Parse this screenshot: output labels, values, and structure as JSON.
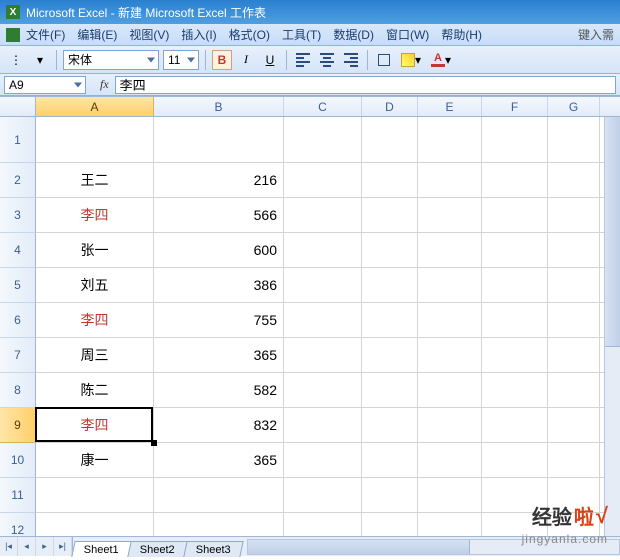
{
  "title": "Microsoft Excel - 新建 Microsoft Excel 工作表",
  "menu": {
    "file": "文件(F)",
    "edit": "编辑(E)",
    "view": "视图(V)",
    "insert": "插入(I)",
    "format": "格式(O)",
    "tools": "工具(T)",
    "data": "数据(D)",
    "window": "窗口(W)",
    "help": "帮助(H)",
    "hint": "键入需"
  },
  "toolbar": {
    "font_name": "宋体",
    "font_size": "11",
    "bold": "B",
    "italic": "I",
    "underline": "U",
    "font_letter": "A"
  },
  "namebox": "A9",
  "fx_label": "fx",
  "formula": "李四",
  "columns": {
    "widths": {
      "A": 118,
      "B": 130,
      "C": 78,
      "D": 56,
      "E": 64,
      "F": 66,
      "G": 52
    },
    "labels": {
      "A": "A",
      "B": "B",
      "C": "C",
      "D": "D",
      "E": "E",
      "F": "F",
      "G": "G"
    }
  },
  "rows": [
    {
      "n": "1",
      "A": "",
      "B": "",
      "red": false
    },
    {
      "n": "2",
      "A": "王二",
      "B": "216",
      "red": false
    },
    {
      "n": "3",
      "A": "李四",
      "B": "566",
      "red": true
    },
    {
      "n": "4",
      "A": "张一",
      "B": "600",
      "red": false
    },
    {
      "n": "5",
      "A": "刘五",
      "B": "386",
      "red": false
    },
    {
      "n": "6",
      "A": "李四",
      "B": "755",
      "red": true
    },
    {
      "n": "7",
      "A": "周三",
      "B": "365",
      "red": false
    },
    {
      "n": "8",
      "A": "陈二",
      "B": "582",
      "red": false
    },
    {
      "n": "9",
      "A": "李四",
      "B": "832",
      "red": true
    },
    {
      "n": "10",
      "A": "康一",
      "B": "365",
      "red": false
    },
    {
      "n": "11",
      "A": "",
      "B": "",
      "red": false
    },
    {
      "n": "12",
      "A": "",
      "B": "",
      "red": false
    }
  ],
  "sheets": {
    "s1": "Sheet1",
    "s2": "Sheet2",
    "s3": "Sheet3"
  },
  "active_cell": {
    "row_index": 8,
    "col": "A"
  },
  "watermark": {
    "main_a": "经验",
    "main_b": "啦",
    "check": "√",
    "sub": "jingyanla.com"
  }
}
